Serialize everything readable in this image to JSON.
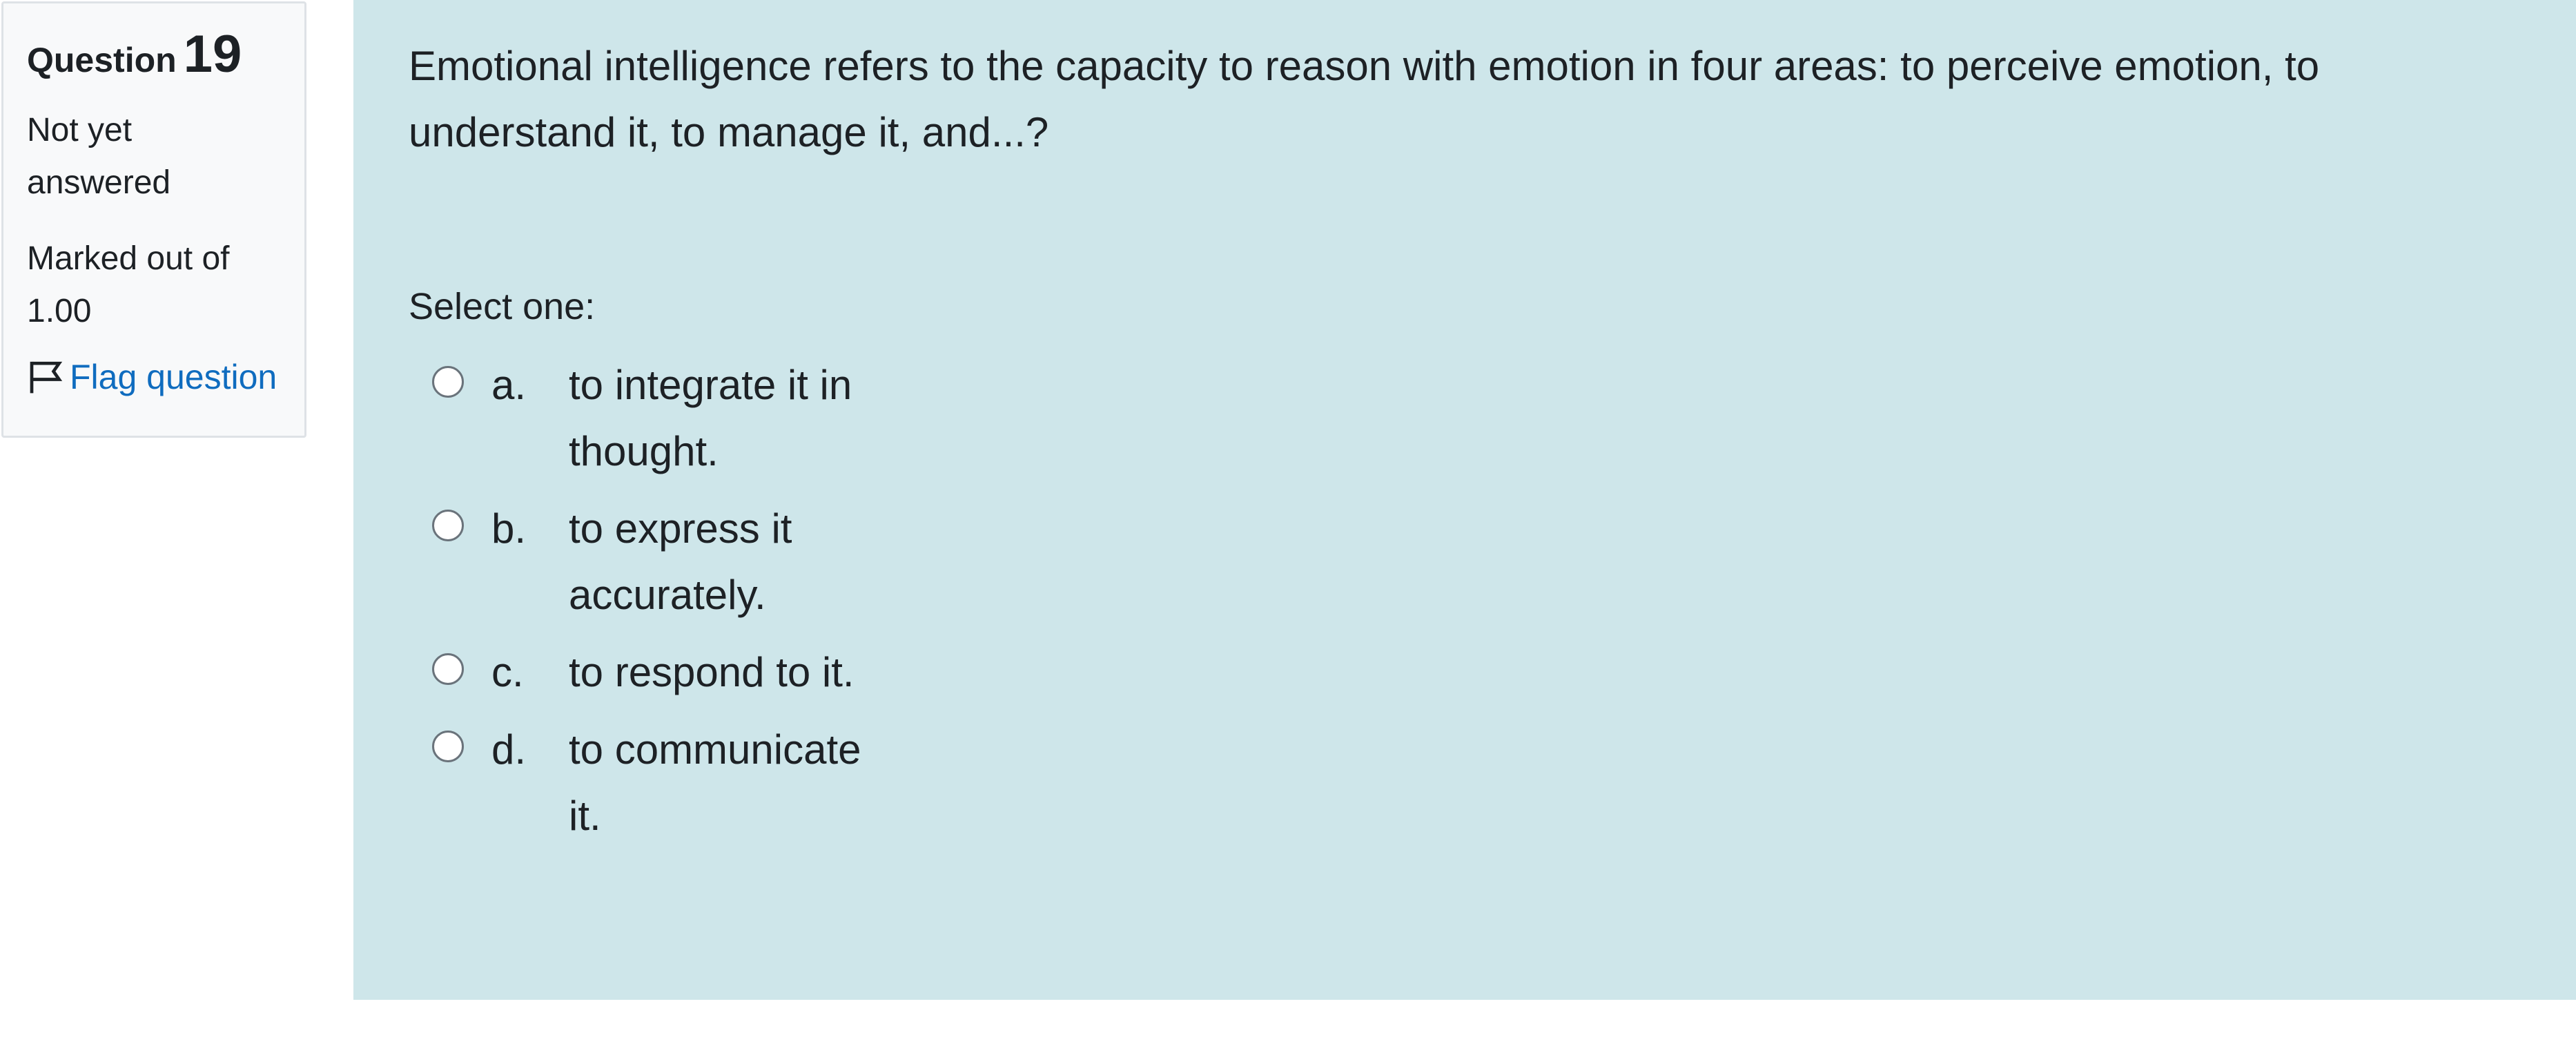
{
  "info": {
    "question_word": "Question",
    "question_number": "19",
    "state": "Not yet answered",
    "grade": "Marked out of 1.00",
    "flag_label": "Flag question"
  },
  "question": {
    "text": "Emotional intelligence refers to the capacity to reason with emotion in four areas: to perceive emotion, to understand it, to manage it, and...?",
    "prompt": "Select one:",
    "answers": [
      {
        "letter": "a.",
        "text": "to integrate it in thought."
      },
      {
        "letter": "b.",
        "text": "to express it accurately."
      },
      {
        "letter": "c.",
        "text": "to respond to it."
      },
      {
        "letter": "d.",
        "text": "to communicate it."
      }
    ]
  },
  "colors": {
    "panel_background": "#cee6ea",
    "info_background": "#f8f9fa",
    "link": "#0f6cbf"
  }
}
